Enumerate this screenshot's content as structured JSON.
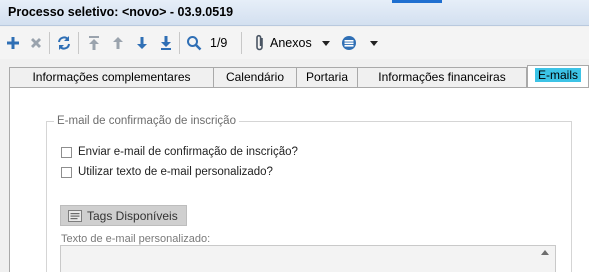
{
  "window": {
    "title": "Processo seletivo: <novo> - 03.9.0519"
  },
  "toolbar": {
    "icons": [
      "plus-icon",
      "delete-icon",
      "refresh-icon",
      "first-record-icon",
      "previous-record-icon",
      "next-record-icon",
      "last-record-icon",
      "search-icon",
      "paperclip-icon",
      "options-icon"
    ],
    "record_counter": "1/9",
    "attachments_label": "Anexos"
  },
  "tabs": [
    {
      "label": "Informações complementares",
      "active": false
    },
    {
      "label": "Calendário",
      "active": false
    },
    {
      "label": "Portaria",
      "active": false
    },
    {
      "label": "Informações financeiras",
      "active": false
    },
    {
      "label": "E-mails",
      "active": true
    }
  ],
  "email_group": {
    "legend": "E-mail de confirmação de inscrição",
    "send_confirmation": {
      "label": "Enviar e-mail de confirmação de inscrição?",
      "checked": false
    },
    "use_custom_text": {
      "label": "Utilizar texto de e-mail personalizado?",
      "checked": false
    },
    "tags_button_label": "Tags Disponíveis",
    "custom_text_label": "Texto de e-mail personalizado:",
    "custom_text_value": ""
  },
  "colors": {
    "accent_blue": "#1f6fd0",
    "active_tab_highlight": "#3cc3e6",
    "plus_green": "#2f6fb5"
  }
}
